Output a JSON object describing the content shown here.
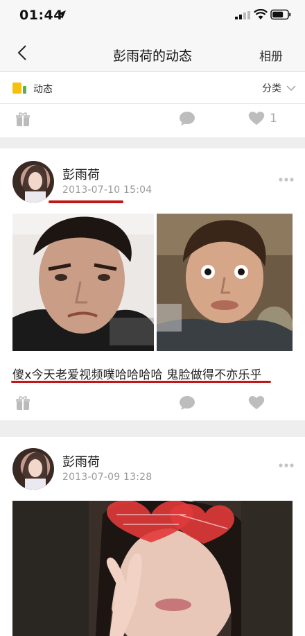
{
  "status_bar": {
    "time": "01:44"
  },
  "nav": {
    "title": "彭雨荷的动态",
    "album": "相册"
  },
  "filter": {
    "label": "动态",
    "category": "分类"
  },
  "top_actions": {
    "like_count": "1"
  },
  "posts": [
    {
      "username": "彭雨荷",
      "time": "2013-07-10 15:04",
      "text": "傻x今天老爱视频噗哈哈哈哈 鬼脸做得不亦乐乎"
    },
    {
      "username": "彭雨荷",
      "time": "2013-07-09 13:28"
    }
  ],
  "colors": {
    "accent_underline": "#c01818",
    "filter_icon": "#f4c20d",
    "meta_gray": "#9a9a9a"
  }
}
